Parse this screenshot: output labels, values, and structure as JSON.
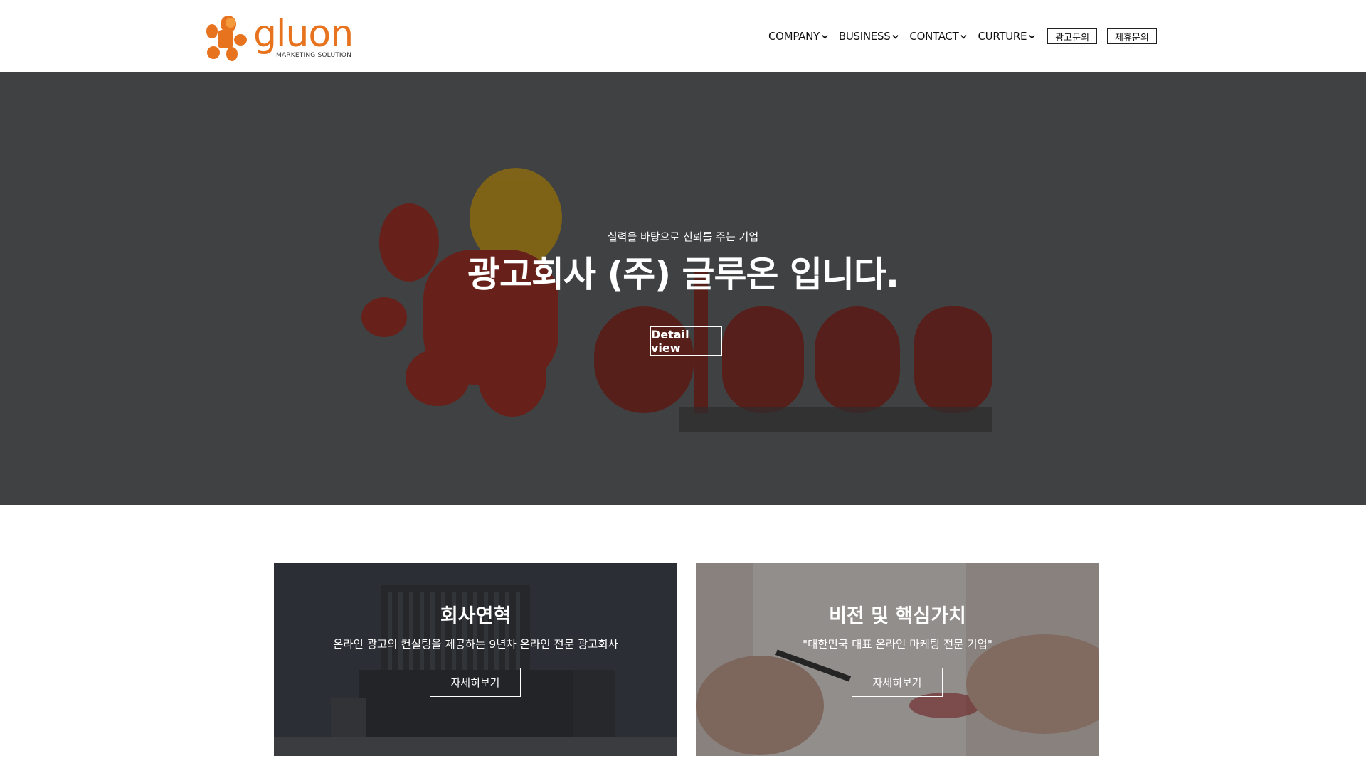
{
  "brand": {
    "name": "gluon",
    "tagline": "MARKETING SOLUTION",
    "accent_color": "#e8731e"
  },
  "nav": {
    "items": [
      {
        "label": "COMPANY",
        "icon": "chevron-down-icon"
      },
      {
        "label": "BUSINESS",
        "icon": "chevron-down-icon"
      },
      {
        "label": "CONTACT",
        "icon": "chevron-down-icon"
      },
      {
        "label": "CURTURE",
        "icon": "chevron-down-icon"
      }
    ],
    "buttons": [
      {
        "label": "광고문의"
      },
      {
        "label": "제휴문의"
      }
    ]
  },
  "hero": {
    "subtitle": "실력을 바탕으로 신뢰를 주는 기업",
    "title": "광고회사 (주) 글루온 입니다.",
    "button_label": "Detail view",
    "background_color": "#3f4143"
  },
  "cards": [
    {
      "title": "회사연혁",
      "description": "온라인 광고의 컨설팅을 제공하는 9년차 온라인 전문 광고회사",
      "button_label": "자세히보기"
    },
    {
      "title": "비전 및 핵심가치",
      "description": "\"대한민국 대표 온라인 마케팅 전문 기업\"",
      "button_label": "자세히보기"
    }
  ]
}
